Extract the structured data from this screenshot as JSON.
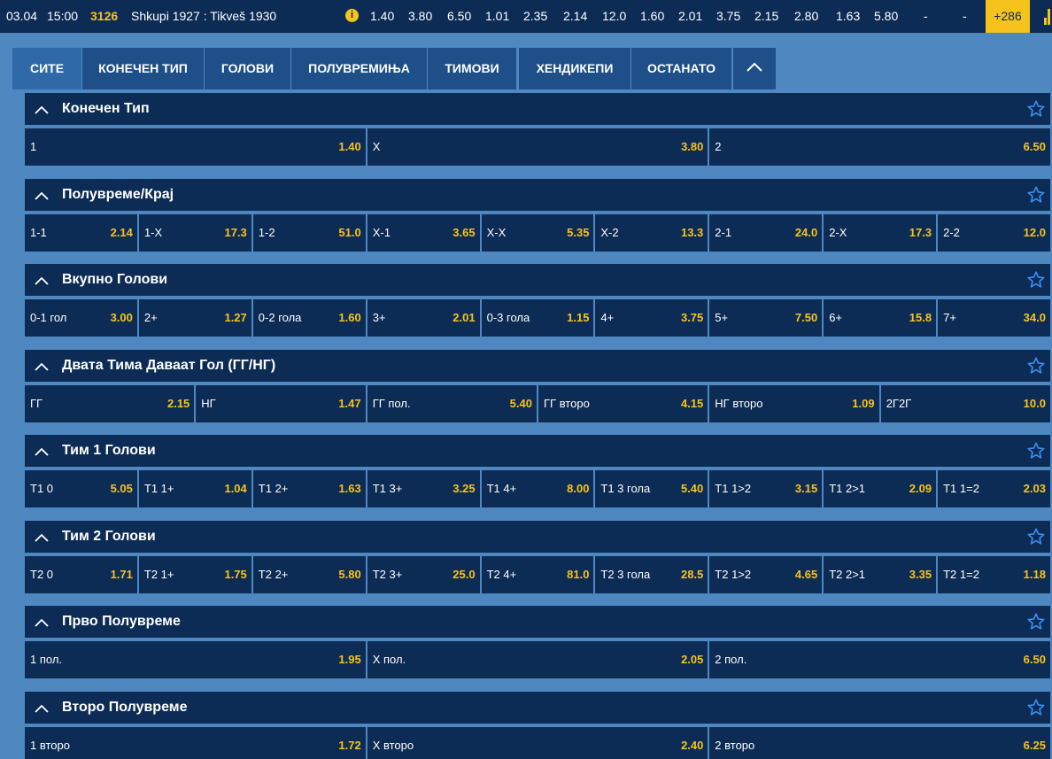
{
  "match": {
    "date": "03.04",
    "time": "15:00",
    "code": "3126",
    "teams": "Shkupi 1927 : Tikveš 1930",
    "info_icon": "info-icon",
    "odds": [
      "1.40",
      "3.80",
      "6.50",
      "1.01",
      "2.35",
      "2.14",
      "12.0",
      "1.60",
      "2.01",
      "3.75",
      "2.15",
      "2.80",
      "1.63",
      "5.80",
      "-",
      "-"
    ],
    "more_count": "+286",
    "stats_icon": "bar-chart-icon"
  },
  "tabs": [
    {
      "label": "СИТЕ",
      "active": true
    },
    {
      "label": "КОНЕЧЕН ТИП",
      "active": false
    },
    {
      "label": "ГОЛОВИ",
      "active": false
    },
    {
      "label": "ПОЛУВРЕМИЊА",
      "active": false
    },
    {
      "label": "ТИМОВИ",
      "active": false
    },
    {
      "label": "ХЕНДИКЕПИ",
      "active": false
    },
    {
      "label": "ОСТАНАТО",
      "active": false
    }
  ],
  "colors": {
    "background": "#4f87c1",
    "panel": "#0d2c55",
    "tab": "#1e4f88",
    "tab_active": "#2f69a8",
    "odd": "#f6c31c",
    "star": "#3a8df0"
  },
  "sections": [
    {
      "title": "Конечен Тип",
      "cells": [
        {
          "label": "1",
          "odd": "1.40"
        },
        {
          "label": "X",
          "odd": "3.80"
        },
        {
          "label": "2",
          "odd": "6.50"
        }
      ]
    },
    {
      "title": "Полувреме/Крај",
      "cells": [
        {
          "label": "1-1",
          "odd": "2.14"
        },
        {
          "label": "1-X",
          "odd": "17.3"
        },
        {
          "label": "1-2",
          "odd": "51.0"
        },
        {
          "label": "X-1",
          "odd": "3.65"
        },
        {
          "label": "X-X",
          "odd": "5.35"
        },
        {
          "label": "X-2",
          "odd": "13.3"
        },
        {
          "label": "2-1",
          "odd": "24.0"
        },
        {
          "label": "2-X",
          "odd": "17.3"
        },
        {
          "label": "2-2",
          "odd": "12.0"
        }
      ]
    },
    {
      "title": "Вкупно Голови",
      "cells": [
        {
          "label": "0-1 гол",
          "odd": "3.00"
        },
        {
          "label": "2+",
          "odd": "1.27"
        },
        {
          "label": "0-2 гола",
          "odd": "1.60"
        },
        {
          "label": "3+",
          "odd": "2.01"
        },
        {
          "label": "0-3 гола",
          "odd": "1.15"
        },
        {
          "label": "4+",
          "odd": "3.75"
        },
        {
          "label": "5+",
          "odd": "7.50"
        },
        {
          "label": "6+",
          "odd": "15.8"
        },
        {
          "label": "7+",
          "odd": "34.0"
        }
      ]
    },
    {
      "title": "Двата Тима Даваат Гол (ГГ/НГ)",
      "cells": [
        {
          "label": "ГГ",
          "odd": "2.15"
        },
        {
          "label": "НГ",
          "odd": "1.47"
        },
        {
          "label": "ГГ пол.",
          "odd": "5.40"
        },
        {
          "label": "ГГ второ",
          "odd": "4.15"
        },
        {
          "label": "НГ второ",
          "odd": "1.09"
        },
        {
          "label": "2Г2Г",
          "odd": "10.0"
        }
      ]
    },
    {
      "title": "Тим 1 Голови",
      "cells": [
        {
          "label": "Т1 0",
          "odd": "5.05"
        },
        {
          "label": "Т1 1+",
          "odd": "1.04"
        },
        {
          "label": "Т1 2+",
          "odd": "1.63"
        },
        {
          "label": "Т1 3+",
          "odd": "3.25"
        },
        {
          "label": "Т1 4+",
          "odd": "8.00"
        },
        {
          "label": "Т1 3 гола",
          "odd": "5.40"
        },
        {
          "label": "Т1 1>2",
          "odd": "3.15"
        },
        {
          "label": "Т1 2>1",
          "odd": "2.09"
        },
        {
          "label": "Т1 1=2",
          "odd": "2.03"
        }
      ]
    },
    {
      "title": "Тим 2 Голови",
      "cells": [
        {
          "label": "Т2 0",
          "odd": "1.71"
        },
        {
          "label": "Т2 1+",
          "odd": "1.75"
        },
        {
          "label": "Т2 2+",
          "odd": "5.80"
        },
        {
          "label": "Т2 3+",
          "odd": "25.0"
        },
        {
          "label": "Т2 4+",
          "odd": "81.0"
        },
        {
          "label": "Т2 3 гола",
          "odd": "28.5"
        },
        {
          "label": "Т2 1>2",
          "odd": "4.65"
        },
        {
          "label": "Т2 2>1",
          "odd": "3.35"
        },
        {
          "label": "Т2 1=2",
          "odd": "1.18"
        }
      ]
    },
    {
      "title": "Прво Полувреме",
      "cells": [
        {
          "label": "1 пол.",
          "odd": "1.95"
        },
        {
          "label": "X пол.",
          "odd": "2.05"
        },
        {
          "label": "2 пол.",
          "odd": "6.50"
        }
      ]
    },
    {
      "title": "Второ Полувреме",
      "cells": [
        {
          "label": "1 второ",
          "odd": "1.72"
        },
        {
          "label": "X второ",
          "odd": "2.40"
        },
        {
          "label": "2 второ",
          "odd": "6.25"
        }
      ]
    }
  ]
}
